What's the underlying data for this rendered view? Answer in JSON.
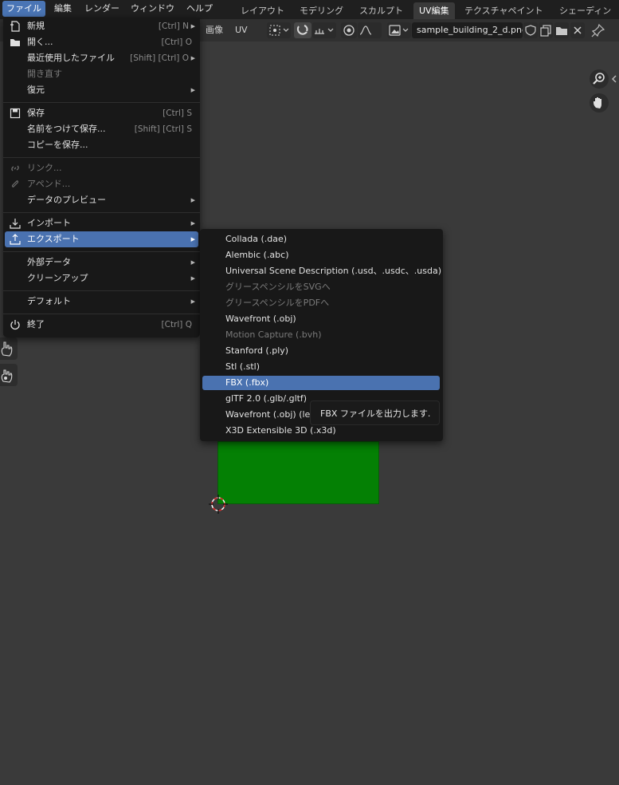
{
  "menubar": {
    "items": [
      "ファイル",
      "編集",
      "レンダー",
      "ウィンドウ",
      "ヘルプ"
    ]
  },
  "workspaces": {
    "tabs": [
      "レイアウト",
      "モデリング",
      "スカルプト",
      "UV編集",
      "テクスチャペイント",
      "シェーディング"
    ],
    "active": "UV編集"
  },
  "editor_header": {
    "image_menu": "画像",
    "uv_menu": "UV",
    "filename": "sample_building_2_d.png"
  },
  "file_menu": {
    "items": [
      {
        "label": "新規",
        "shortcut": "[Ctrl] N",
        "icon": "new-file-icon",
        "submenu": true
      },
      {
        "label": "開く...",
        "shortcut": "[Ctrl] O",
        "icon": "folder-icon"
      },
      {
        "label": "最近使用したファイル",
        "shortcut": "[Shift] [Ctrl] O",
        "submenu": true
      },
      {
        "label": "開き直す",
        "disabled": true
      },
      {
        "label": "復元",
        "submenu": true
      },
      {
        "label": "保存",
        "shortcut": "[Ctrl] S",
        "icon": "save-icon"
      },
      {
        "label": "名前をつけて保存...",
        "shortcut": "[Shift] [Ctrl] S"
      },
      {
        "label": "コピーを保存..."
      },
      {
        "label": "リンク...",
        "disabled": true,
        "icon": "link-icon"
      },
      {
        "label": "アペンド...",
        "disabled": true,
        "icon": "append-icon"
      },
      {
        "label": "データのプレビュー",
        "submenu": true
      },
      {
        "label": "インポート",
        "icon": "import-icon",
        "submenu": true
      },
      {
        "label": "エクスポート",
        "icon": "export-icon",
        "submenu": true,
        "highlighted": true
      },
      {
        "label": "外部データ",
        "submenu": true
      },
      {
        "label": "クリーンアップ",
        "submenu": true
      },
      {
        "label": "デフォルト",
        "submenu": true
      },
      {
        "label": "終了",
        "shortcut": "[Ctrl] Q",
        "icon": "power-icon"
      }
    ]
  },
  "export_submenu": {
    "items": [
      {
        "label": "Collada (.dae)"
      },
      {
        "label": "Alembic (.abc)"
      },
      {
        "label": "Universal Scene Description (.usd、.usdc、.usda)"
      },
      {
        "label": "グリースペンシルをSVGへ",
        "disabled": true
      },
      {
        "label": "グリースペンシルをPDFへ",
        "disabled": true
      },
      {
        "label": "Wavefront (.obj)"
      },
      {
        "label": "Motion Capture (.bvh)",
        "disabled": true
      },
      {
        "label": "Stanford (.ply)"
      },
      {
        "label": "Stl (.stl)"
      },
      {
        "label": "FBX (.fbx)",
        "highlighted": true
      },
      {
        "label": "glTF 2.0 (.glb/.gltf)"
      },
      {
        "label": "Wavefront (.obj) (lega"
      },
      {
        "label": "X3D Extensible 3D (.x3d)"
      }
    ]
  },
  "tooltip": {
    "text": "FBX ファイルを出力します."
  },
  "colors": {
    "menu_highlight": "#4a72b0",
    "uv_island": "#048004",
    "background": "#3a3a3a"
  }
}
